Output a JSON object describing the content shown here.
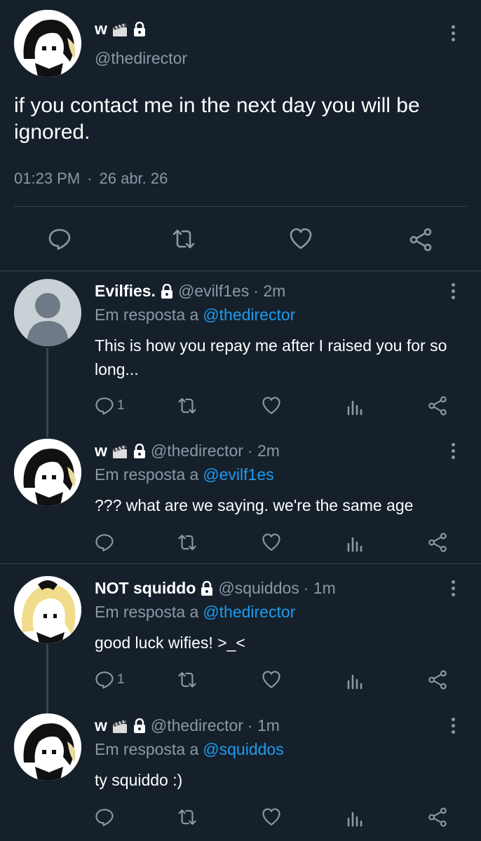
{
  "main_tweet": {
    "name": "w",
    "handle": "@thedirector",
    "text": "if you contact me in the next day you will be ignored.",
    "time": "01:23 PM",
    "sep": "·",
    "date": "26 abr. 26"
  },
  "replies": [
    {
      "name": "Evilfies.",
      "handle": "@evilf1es",
      "age": "· 2m",
      "reply_prefix": "Em resposta a",
      "reply_to": "@thedirector",
      "text": "This is how you repay me after I raised you for so long...",
      "reply_count": "1"
    },
    {
      "name": "w",
      "handle": "@thedirector",
      "age": "· 2m",
      "reply_prefix": "Em resposta a",
      "reply_to": "@evilf1es",
      "text": "??? what are we saying. we're the same age",
      "reply_count": ""
    },
    {
      "name": "NOT squiddo",
      "handle": "@squiddos",
      "age": "· 1m",
      "reply_prefix": "Em resposta a",
      "reply_to": "@thedirector",
      "text": "good luck wifies! >_<",
      "reply_count": "1"
    },
    {
      "name": "w",
      "handle": "@thedirector",
      "age": "· 1m",
      "reply_prefix": "Em resposta a",
      "reply_to": "@squiddos",
      "text": "ty squiddo :)",
      "reply_count": ""
    }
  ],
  "icons": [
    "clapper-icon",
    "lock-icon",
    "reply-icon",
    "retweet-icon",
    "like-icon",
    "analytics-icon",
    "share-icon",
    "more-icon"
  ],
  "colors": {
    "background": "#15202b",
    "text": "#ffffff",
    "muted": "#8b98a5",
    "link": "#1d9bf0",
    "divider": "#38444d"
  }
}
